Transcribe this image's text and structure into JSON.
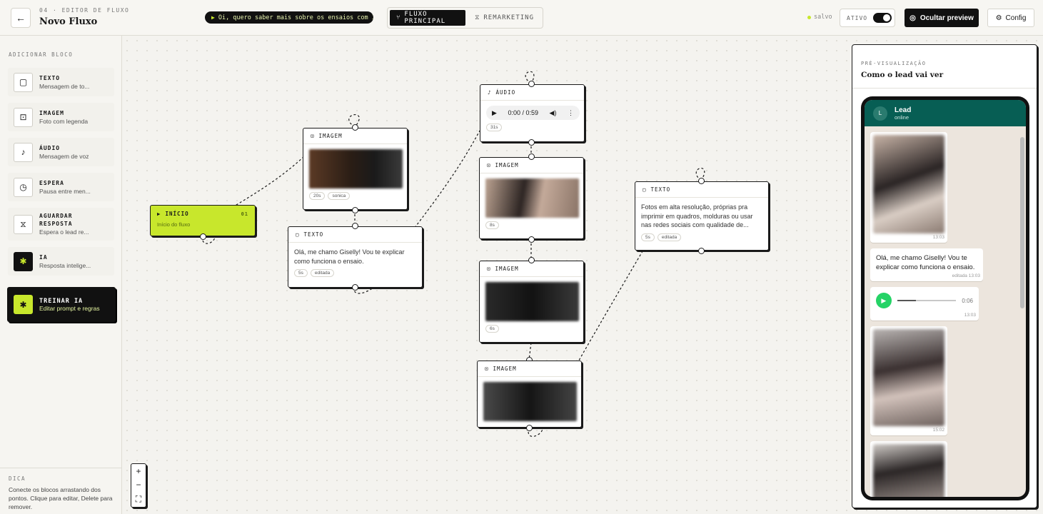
{
  "header": {
    "breadcrumb": "04 · EDITOR DE FLUXO",
    "title": "Novo Fluxo",
    "ai_prompt": "Oi, quero saber mais sobre os ensaios com IA.",
    "tabs": [
      {
        "label": "FLUXO PRINCIPAL",
        "active": true
      },
      {
        "label": "REMARKETING",
        "active": false
      }
    ],
    "saved": "salvo",
    "active_label": "ATIVO",
    "active_on": true,
    "preview_label": "Ocultar preview",
    "config_label": "Config"
  },
  "sidebar": {
    "title": "ADICIONAR BLOCO",
    "blocks": [
      {
        "label": "TEXTO",
        "desc": "Mensagem de to...",
        "icon": "message-icon"
      },
      {
        "label": "IMAGEM",
        "desc": "Foto com legenda",
        "icon": "image-icon"
      },
      {
        "label": "ÁUDIO",
        "desc": "Mensagem de voz",
        "icon": "mic-icon"
      },
      {
        "label": "ESPERA",
        "desc": "Pausa entre men...",
        "icon": "clock-icon"
      },
      {
        "label": "AGUARDAR",
        "label2": "RESPOSTA",
        "desc": "Espera o lead re...",
        "icon": "hourglass-icon"
      },
      {
        "label": "IA",
        "desc": "Resposta intelige...",
        "icon": "ai-icon"
      }
    ],
    "train": {
      "label": "TREINAR IA",
      "desc": "Editar prompt e regras"
    },
    "tip_title": "DICA",
    "tip_body": "Conecte os blocos arrastando dos pontos. Clique para editar, Delete para remover."
  },
  "nodes": {
    "start": {
      "label": "INÍCIO",
      "num": "01",
      "sub": "Início do fluxo"
    },
    "img1": {
      "label": "IMAGEM",
      "tags": [
        "20s",
        "sonica"
      ]
    },
    "text1": {
      "label": "TEXTO",
      "body": "Olá, me chamo Giselly! Vou te explicar como funciona o ensaio.",
      "tags": [
        "5s",
        "editada"
      ]
    },
    "audio": {
      "label": "ÁUDIO",
      "time": "0:00 / 0:59",
      "tags": [
        "31s"
      ]
    },
    "img2": {
      "label": "IMAGEM",
      "tags": [
        "8s"
      ]
    },
    "img3": {
      "label": "IMAGEM",
      "tags": [
        "6s"
      ]
    },
    "img4": {
      "label": "IMAGEM"
    },
    "text2": {
      "label": "TEXTO",
      "body": "Fotos em alta resolução, próprias pra imprimir em quadros, molduras ou usar nas redes sociais com qualidade de...",
      "tags": [
        "5s",
        "editada"
      ]
    }
  },
  "preview": {
    "overline": "PRÉ-VISUALIZAÇÃO",
    "title": "Como o lead vai ver",
    "contact": {
      "avatar": "L",
      "name": "Lead",
      "status": "online"
    },
    "messages": [
      {
        "type": "image",
        "time": "13:03"
      },
      {
        "type": "text",
        "text": "Olá, me chamo Giselly! Vou te explicar como funciona o ensaio.",
        "time": "editada 13:03"
      },
      {
        "type": "audio",
        "duration": "0:06",
        "time": "13:03"
      },
      {
        "type": "image",
        "time": "15:02"
      },
      {
        "type": "image",
        "time": ""
      }
    ]
  },
  "colors": {
    "accent": "#c8e72c",
    "dark": "#111111",
    "wa_header": "#075e54",
    "wa_green": "#25d366"
  }
}
